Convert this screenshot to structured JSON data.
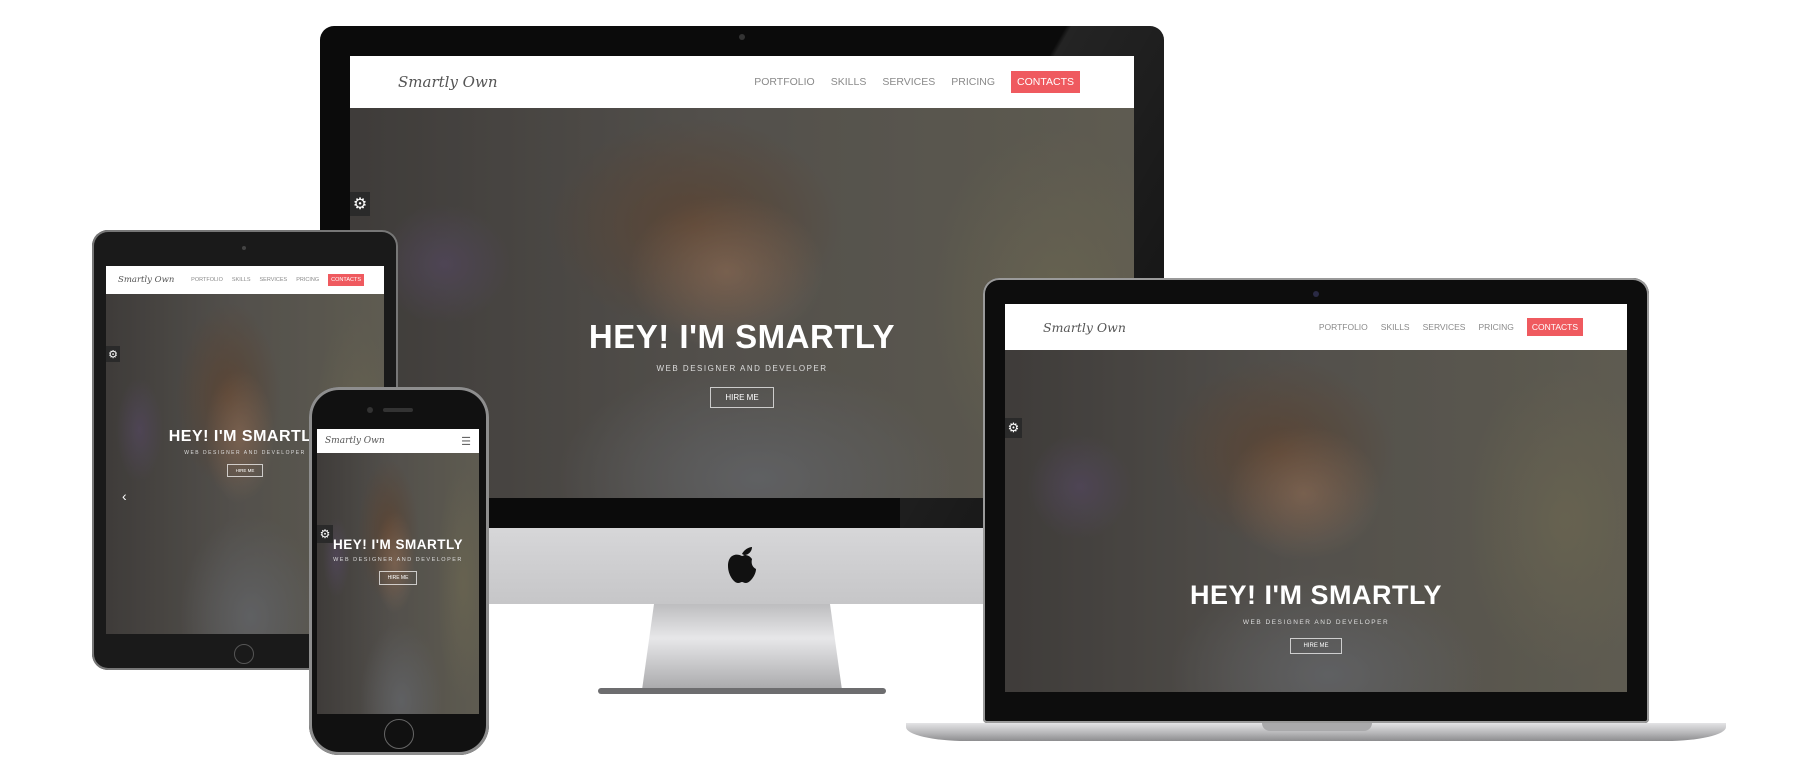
{
  "site": {
    "logo": "Smartly Own",
    "nav": [
      "PORTFOLIO",
      "SKILLS",
      "SERVICES",
      "PRICING"
    ],
    "nav_cta": "CONTACTS",
    "hero_title": "HEY! I'M SMARTLY",
    "hero_subtitle": "WEB DESIGNER AND DEVELOPER",
    "hero_button": "HIRE ME"
  },
  "icons": {
    "settings": "gear-icon",
    "menu": "hamburger-icon",
    "prev": "chevron-left-icon",
    "brand": "apple-logo-icon"
  },
  "colors": {
    "accent": "#ef5a5f",
    "bezel": "#0b0b0b",
    "imac_chin": "#c9c9cb"
  }
}
